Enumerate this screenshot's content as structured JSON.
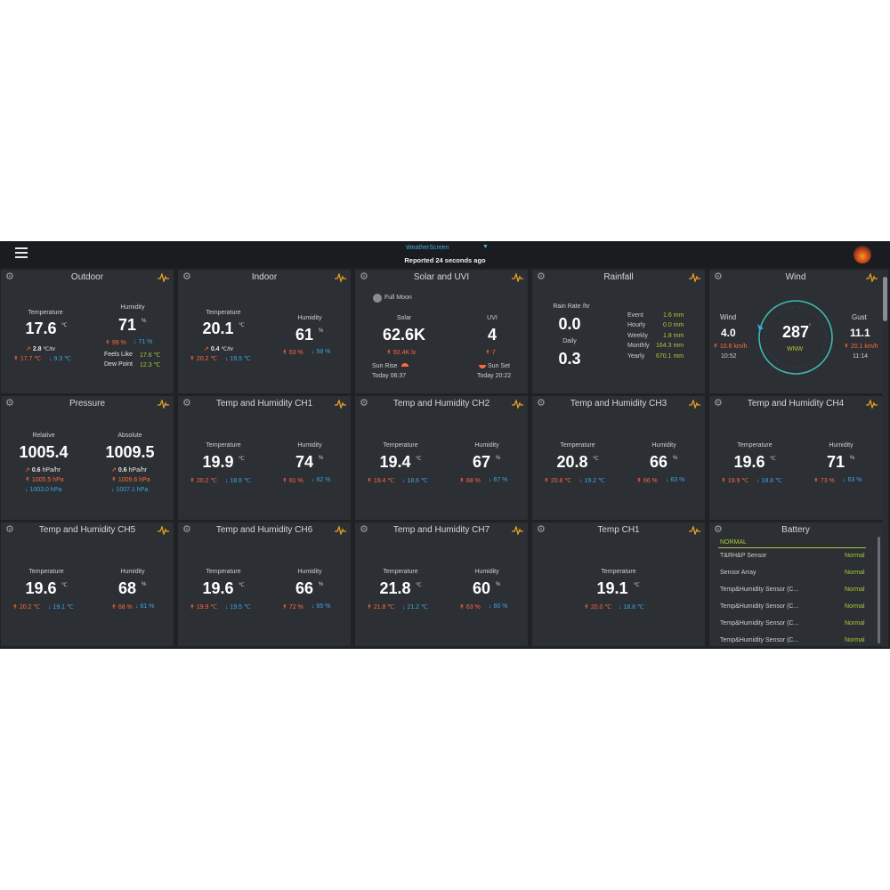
{
  "header": {
    "station": "WeatherScreen",
    "reported": "Reported 24 seconds ago"
  },
  "outdoor": {
    "title": "Outdoor",
    "temp_label": "Temperature",
    "temp": "17.6",
    "temp_unit": "℃",
    "trend": "2.8",
    "trend_unit": "℃/hr",
    "temp_hi": "17.7 ℃",
    "temp_lo": "9.3 ℃",
    "hum_label": "Humidity",
    "hum": "71",
    "hum_unit": "%",
    "hum_hi": "99 %",
    "hum_lo": "71 %",
    "feels_label": "Feels Like",
    "feels": "17.6 ℃",
    "dew_label": "Dew Point",
    "dew": "12.3 ℃"
  },
  "indoor": {
    "title": "Indoor",
    "temp_label": "Temperature",
    "temp": "20.1",
    "temp_unit": "℃",
    "trend": "0.4",
    "trend_unit": "℃/hr",
    "temp_hi": "20.2 ℃",
    "temp_lo": "19.5 ℃",
    "hum_label": "Humidity",
    "hum": "61",
    "hum_unit": "%",
    "hum_hi": "63 %",
    "hum_lo": "58 %"
  },
  "solar": {
    "title": "Solar and UVI",
    "moon": "Full Moon",
    "solar_label": "Solar",
    "solar": "62.6K",
    "solar_hi": "92.4K lx",
    "uvi_label": "UVI",
    "uvi": "4",
    "uvi_hi": "7",
    "sunrise_label": "Sun Rise",
    "sunrise": "Today 06:37",
    "sunset_label": "Sun Set",
    "sunset": "Today 20:22"
  },
  "rainfall": {
    "title": "Rainfall",
    "rate_label": "Rain Rate /hr",
    "rate": "0.0",
    "daily_label": "Daily",
    "daily": "0.3",
    "rows": [
      {
        "label": "Event",
        "value": "1.6 mm"
      },
      {
        "label": "Hourly",
        "value": "0.0 mm"
      },
      {
        "label": "Weekly",
        "value": "1.8 mm"
      },
      {
        "label": "Monthly",
        "value": "164.3 mm"
      },
      {
        "label": "Yearly",
        "value": "670.1 mm"
      }
    ]
  },
  "wind": {
    "title": "Wind",
    "wind_label": "Wind",
    "wind": "4.0",
    "wind_hi": "10.8 km/h",
    "wind_time": "10:52",
    "direction": "287",
    "direction_unit": "°",
    "compass": "WNW",
    "gust_label": "Gust",
    "gust": "11.1",
    "gust_hi": "20.1 km/h",
    "gust_time": "11:14"
  },
  "pressure": {
    "title": "Pressure",
    "rel_label": "Relative",
    "rel": "1005.4",
    "rel_trend": "0.6",
    "rel_trend_unit": "hPa/hr",
    "rel_hi": "1005.5 hPa",
    "rel_lo": "1003.0 hPa",
    "abs_label": "Absolute",
    "abs": "1009.5",
    "abs_trend": "0.6",
    "abs_trend_unit": "hPa/hr",
    "abs_hi": "1009.6 hPa",
    "abs_lo": "1007.1 hPa"
  },
  "channels": [
    {
      "title": "Temp and Humidity CH1",
      "temp": "19.9",
      "temp_hi": "20.2 ℃",
      "temp_lo": "18.6 ℃",
      "hum": "74",
      "hum_hi": "81 %",
      "hum_lo": "62 %"
    },
    {
      "title": "Temp and Humidity CH2",
      "temp": "19.4",
      "temp_hi": "19.4 ℃",
      "temp_lo": "18.6 ℃",
      "hum": "67",
      "hum_hi": "68 %",
      "hum_lo": "67 %"
    },
    {
      "title": "Temp and Humidity CH3",
      "temp": "20.8",
      "temp_hi": "20.8 ℃",
      "temp_lo": "19.2 ℃",
      "hum": "66",
      "hum_hi": "66 %",
      "hum_lo": "63 %"
    },
    {
      "title": "Temp and Humidity CH4",
      "temp": "19.6",
      "temp_hi": "19.9 ℃",
      "temp_lo": "18.8 ℃",
      "hum": "71",
      "hum_hi": "73 %",
      "hum_lo": "63 %"
    },
    {
      "title": "Temp and Humidity CH5",
      "temp": "19.6",
      "temp_hi": "20.2 ℃",
      "temp_lo": "19.1 ℃",
      "hum": "68",
      "hum_hi": "68 %",
      "hum_lo": "61 %"
    },
    {
      "title": "Temp and Humidity CH6",
      "temp": "19.6",
      "temp_hi": "19.9 ℃",
      "temp_lo": "19.5 ℃",
      "hum": "66",
      "hum_hi": "72 %",
      "hum_lo": "65 %"
    },
    {
      "title": "Temp and Humidity CH7",
      "temp": "21.8",
      "temp_hi": "21.8 ℃",
      "temp_lo": "21.2 ℃",
      "hum": "60",
      "hum_hi": "63 %",
      "hum_lo": "60 %"
    }
  ],
  "ch_labels": {
    "temp_label": "Temperature",
    "hum_label": "Humidity",
    "temp_unit": "℃",
    "hum_unit": "%"
  },
  "temp_ch1": {
    "title": "Temp CH1",
    "temp_label": "Temperature",
    "temp": "19.1",
    "temp_unit": "℃",
    "temp_hi": "20.0 ℃",
    "temp_lo": "18.8 ℃"
  },
  "battery": {
    "title": "Battery",
    "status_header": "NORMAL",
    "items": [
      {
        "name": "T&RH&P Sensor",
        "status": "Normal"
      },
      {
        "name": "Sensor Array",
        "status": "Normal"
      },
      {
        "name": "Temp&Humidity Sensor (C...",
        "status": "Normal"
      },
      {
        "name": "Temp&Humidity Sensor (C...",
        "status": "Normal"
      },
      {
        "name": "Temp&Humidity Sensor (C...",
        "status": "Normal"
      },
      {
        "name": "Temp&Humidity Sensor (C...",
        "status": "Normal"
      }
    ]
  },
  "icons": {
    "high": "↟",
    "low": "↓",
    "trend": "⇗"
  },
  "colors": {
    "background": "#1f2124",
    "card": "#2c2f33",
    "high": "#ff6a3d",
    "low": "#3aa7e8",
    "accent": "#a8c93b",
    "compass_ring": "#3fb8b0",
    "pulse_icon": "#e5a023"
  }
}
